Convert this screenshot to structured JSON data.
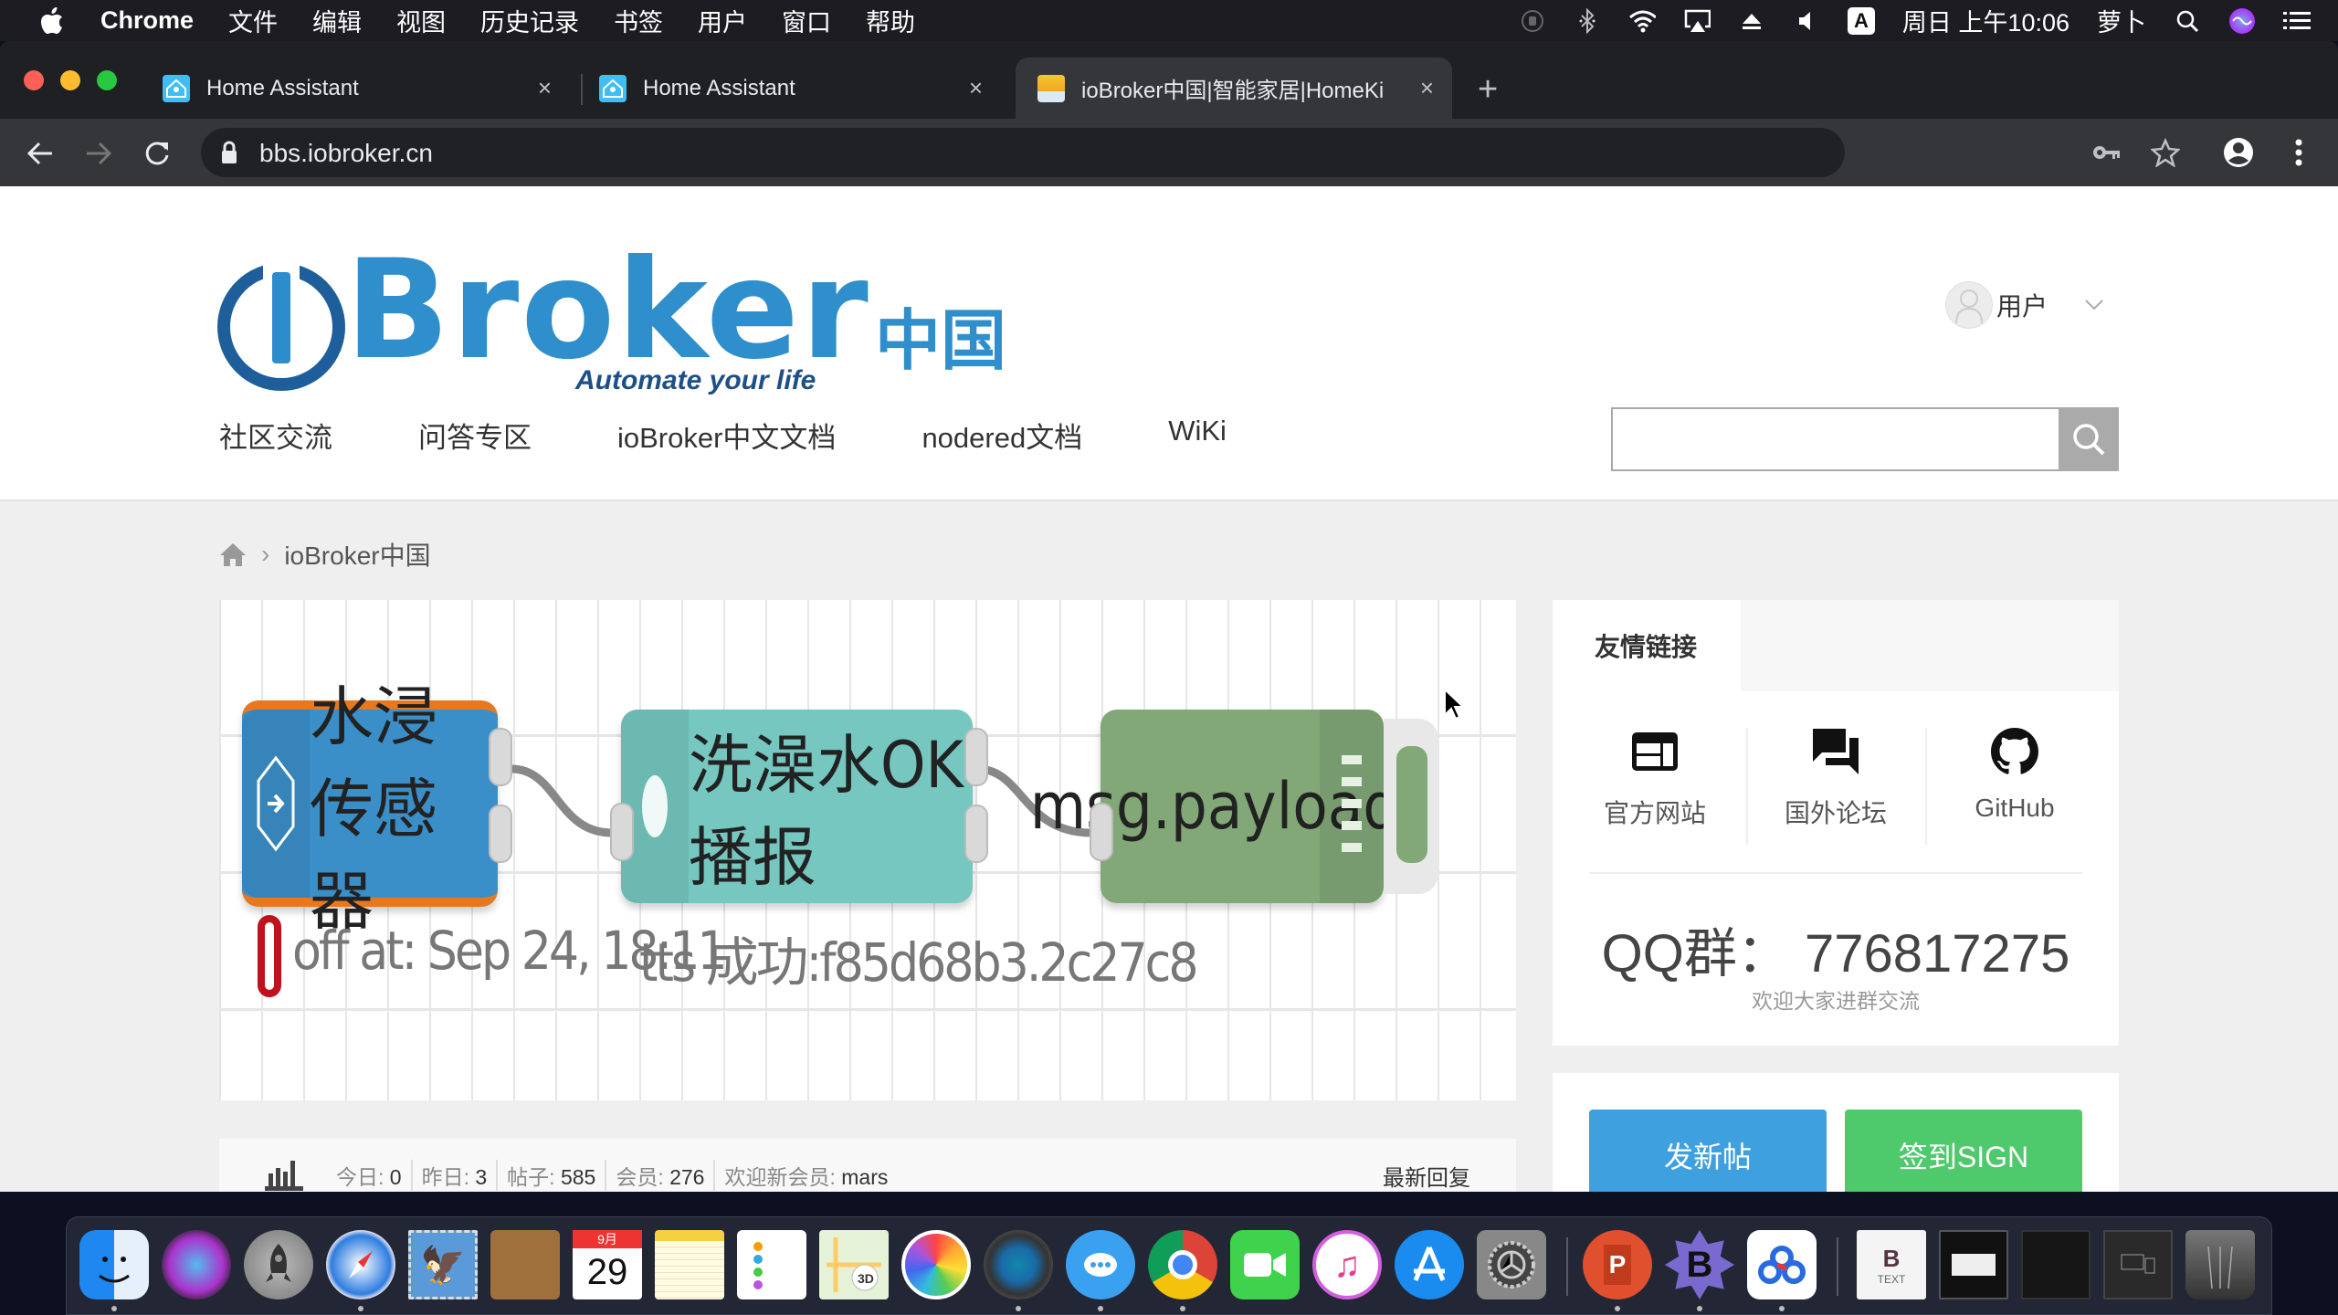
{
  "menubar": {
    "app_name": "Chrome",
    "menus": [
      "文件",
      "编辑",
      "视图",
      "历史记录",
      "书签",
      "用户",
      "窗口",
      "帮助"
    ],
    "status_icons": [
      "screen-record-icon",
      "bluetooth-icon",
      "wifi-icon",
      "airplay-icon",
      "eject-icon",
      "volume-icon"
    ],
    "input_method": "A",
    "clock": "周日 上午10:06",
    "user": "萝卜"
  },
  "browser": {
    "tabs": [
      {
        "title": "Home Assistant",
        "favicon": "home-assistant-icon",
        "active": false
      },
      {
        "title": "Home Assistant",
        "favicon": "home-assistant-icon",
        "active": false
      },
      {
        "title": "ioBroker中国|智能家居|HomeKi",
        "favicon": "iobroker-icon",
        "active": true
      }
    ],
    "new_tab_label": "+",
    "close_label": "×",
    "url": "bbs.iobroker.cn"
  },
  "site": {
    "logo": {
      "word": "Broker",
      "cn": "中国",
      "tagline": "Automate your life"
    },
    "nav": [
      "社区交流",
      "问答专区",
      "ioBroker中文文档",
      "nodered文档",
      "WiKi"
    ],
    "user_menu": {
      "label": "用户"
    },
    "search": {
      "placeholder": "",
      "value": ""
    },
    "breadcrumb": {
      "current": "ioBroker中国",
      "separator": "›"
    }
  },
  "banner": {
    "nodes": [
      {
        "label": "水浸传感器",
        "color": "#3b8fc8",
        "border": "#e8781e"
      },
      {
        "label": "洗澡水OK播报",
        "color": "#75c7c0"
      },
      {
        "label": "msg.payload",
        "color": "#82a878"
      }
    ],
    "status_1": "off at: Sep 24, 18:11",
    "status_2": "tts 成功:f85d68b3.2c27c8"
  },
  "stats": {
    "today_label": "今日:",
    "today": "0",
    "yesterday_label": "昨日:",
    "yesterday": "3",
    "posts_label": "帖子:",
    "posts": "585",
    "members_label": "会员:",
    "members": "276",
    "newest_label": "欢迎新会员:",
    "newest": "mars",
    "latest_replies": "最新回复"
  },
  "sidebar": {
    "links_title": "友情链接",
    "links": [
      {
        "label": "官方网站",
        "icon": "website-icon"
      },
      {
        "label": "国外论坛",
        "icon": "forum-icon"
      },
      {
        "label": "GitHub",
        "icon": "github-icon"
      }
    ],
    "qq": "QQ群： 776817275",
    "qq_sub": "欢迎大家进群交流",
    "new_post": "发新帖",
    "sign_in": "签到SIGN",
    "colors": {
      "new_post": "#3fa0e0",
      "sign_in": "#4ec96c"
    }
  },
  "dock": {
    "apps": [
      "Finder",
      "Siri",
      "Launchpad",
      "Safari",
      "Mail",
      "Contacts",
      "Calendar",
      "Notes",
      "Reminders",
      "Maps",
      "Photos",
      "QuickTime",
      "Messages",
      "Chrome",
      "FaceTime",
      "iTunes",
      "App Store",
      "System Preferences",
      "PowerPoint",
      "BBEdit",
      "Baidu Netdisk",
      "Text File",
      "Chrome Window",
      "BBEdit Window",
      "Messages Window",
      "Trash"
    ],
    "calendar_month": "9月",
    "calendar_day": "29",
    "text_label": "TEXT"
  }
}
